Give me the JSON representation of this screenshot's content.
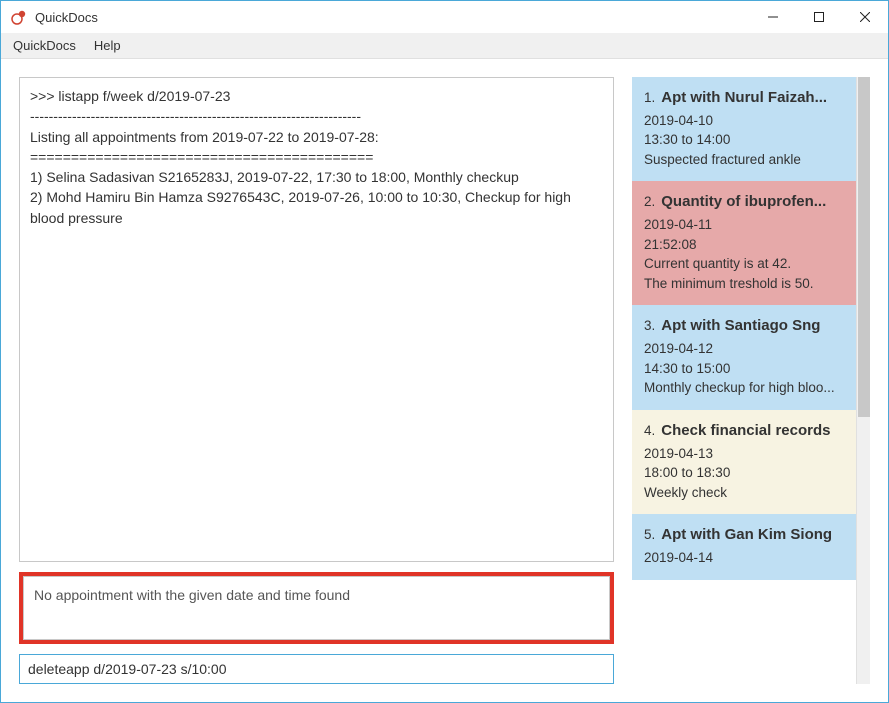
{
  "window": {
    "title": "QuickDocs"
  },
  "menubar": {
    "items": [
      "QuickDocs",
      "Help"
    ]
  },
  "console": {
    "text": ">>> listapp f/week d/2019-07-23\n-----------------------------------------------------------------------\nListing all appointments from 2019-07-22 to 2019-07-28:\n==========================================\n1) Selina Sadasivan S2165283J, 2019-07-22, 17:30 to 18:00, Monthly checkup\n2) Mohd Hamiru Bin Hamza S9276543C, 2019-07-26, 10:00 to 10:30, Checkup for high blood pressure"
  },
  "status": {
    "message": "No appointment with the given date and time found"
  },
  "command": {
    "value": "deleteapp d/2019-07-23 s/10:00"
  },
  "reminders": [
    {
      "color": "blue",
      "idx": "1.",
      "title": "Apt with Nurul Faizah...",
      "date": "2019-04-10",
      "time": "13:30 to 14:00",
      "desc": "Suspected fractured ankle"
    },
    {
      "color": "red",
      "idx": "2.",
      "title": "Quantity of ibuprofen...",
      "date": "2019-04-11",
      "time": "21:52:08",
      "desc": "Current quantity is at 42.",
      "desc2": "The minimum treshold is 50."
    },
    {
      "color": "blue",
      "idx": "3.",
      "title": "Apt with Santiago Sng",
      "date": "2019-04-12",
      "time": "14:30 to 15:00",
      "desc": "Monthly checkup for high bloo..."
    },
    {
      "color": "beige",
      "idx": "4.",
      "title": "Check financial records",
      "date": "2019-04-13",
      "time": "18:00 to 18:30",
      "desc": "Weekly check"
    },
    {
      "color": "blue",
      "idx": "5.",
      "title": "Apt with Gan Kim Siong",
      "date": "2019-04-14",
      "time": "",
      "desc": ""
    }
  ]
}
